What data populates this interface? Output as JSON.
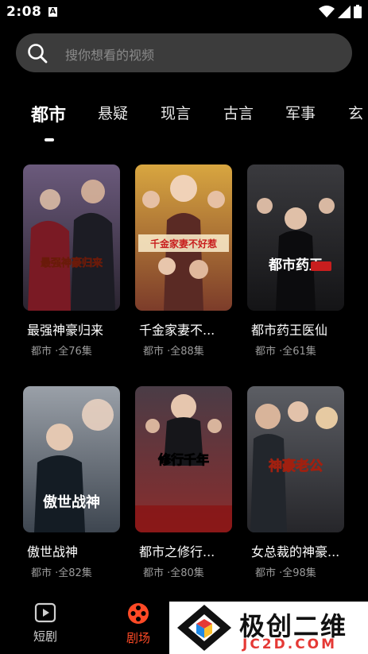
{
  "status_bar": {
    "time": "2:08",
    "notification_letter": "A"
  },
  "search": {
    "placeholder": "搜你想看的视频"
  },
  "tabs": [
    {
      "label": "都市",
      "active": true
    },
    {
      "label": "悬疑",
      "active": false
    },
    {
      "label": "现言",
      "active": false
    },
    {
      "label": "古言",
      "active": false
    },
    {
      "label": "军事",
      "active": false
    },
    {
      "label": "玄",
      "active": false
    }
  ],
  "dramas": [
    {
      "title": "最强神豪归来",
      "meta": "都市 ·全76集",
      "poster_text": "最强神豪归来",
      "poster_colors": [
        "#6b5a7c",
        "#2a2430"
      ]
    },
    {
      "title": "千金家妻不...",
      "meta": "都市 ·全88集",
      "poster_text": "千金家妻不好惹",
      "poster_colors": [
        "#d8a640",
        "#7c3c2a"
      ]
    },
    {
      "title": "都市药王医仙",
      "meta": "都市 ·全61集",
      "poster_text": "都市药王",
      "poster_colors": [
        "#3a3a3e",
        "#141416"
      ]
    },
    {
      "title": "傲世战神",
      "meta": "都市 ·全82集",
      "poster_text": "傲世战神",
      "poster_colors": [
        "#9aa0a8",
        "#3e4650"
      ]
    },
    {
      "title": "都市之修行...",
      "meta": "都市 ·全80集",
      "poster_text": "修行千年",
      "poster_colors": [
        "#4a3c46",
        "#8a2c2c"
      ]
    },
    {
      "title": "女总裁的神豪...",
      "meta": "都市 ·全98集",
      "poster_text": "神豪老公",
      "poster_colors": [
        "#5c5e64",
        "#26262a"
      ]
    }
  ],
  "bottom_nav": [
    {
      "label": "短剧",
      "icon": "play-square-icon",
      "active": false,
      "color": "#cfcfcf"
    },
    {
      "label": "剧场",
      "icon": "film-reel-icon",
      "active": true,
      "color": "#ff4a26"
    }
  ],
  "watermark": {
    "text_cn": "极创二维",
    "text_en": "JC2D.COM"
  },
  "colors": {
    "accent": "#ff4a26",
    "search_bg": "#3c3c3c",
    "meta_text": "#9a9a9a"
  }
}
